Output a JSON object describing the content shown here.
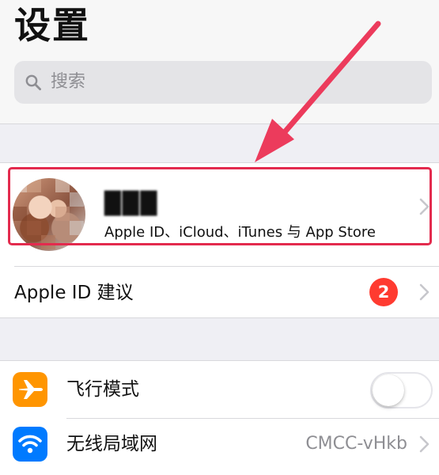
{
  "header": {
    "title": "设置",
    "search_placeholder": "搜索"
  },
  "profile": {
    "name": "███",
    "subtitle": "Apple ID、iCloud、iTunes 与 App Store"
  },
  "suggestion_row": {
    "label": "Apple ID 建议",
    "badge": "2"
  },
  "settings": [
    {
      "label": "飞行模式",
      "icon": "airplane-icon",
      "icon_color": "#ff9500",
      "toggle_on": false
    },
    {
      "label": "无线局域网",
      "icon": "wifi-icon",
      "icon_color": "#007aff",
      "value": "CMCC-vHkb"
    }
  ],
  "colors": {
    "highlight": "#e32b4e",
    "arrow": "#ec3b5c",
    "badge": "#ff3b30",
    "airplane": "#ff9500",
    "wifi": "#007aff"
  }
}
